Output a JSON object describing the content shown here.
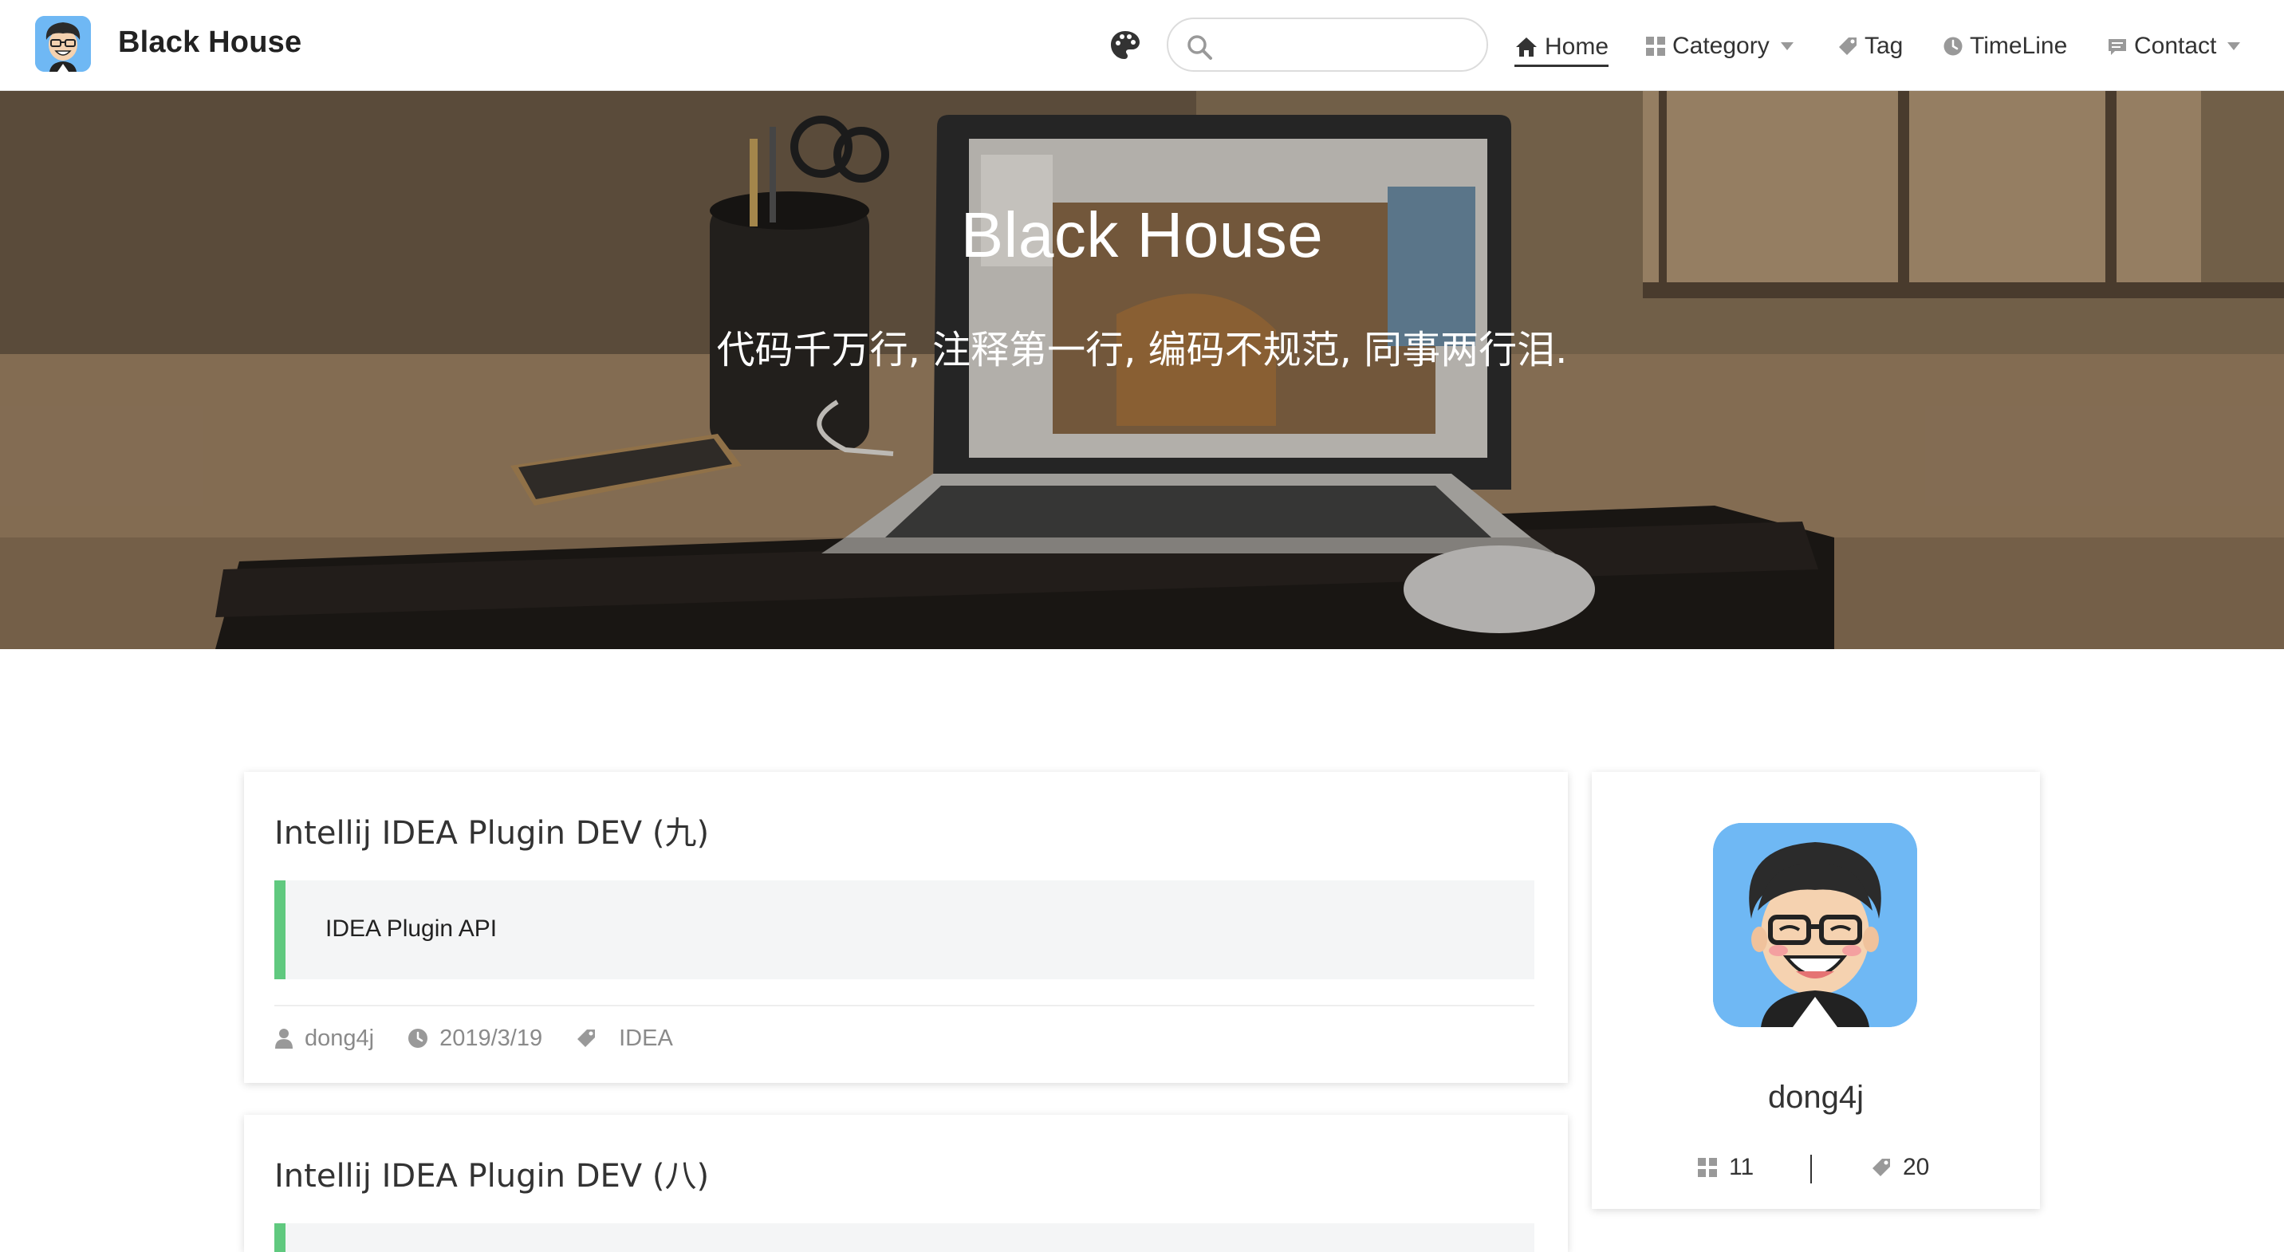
{
  "site": {
    "brand": "Black House",
    "search": {
      "placeholder": "",
      "value": ""
    },
    "nav": [
      {
        "label": "Home",
        "icon": "home-icon",
        "active": true
      },
      {
        "label": "Category",
        "icon": "category-grid-icon",
        "dropdown": true
      },
      {
        "label": "Tag",
        "icon": "tag-icon"
      },
      {
        "label": "TimeLine",
        "icon": "clock-icon"
      },
      {
        "label": "Contact",
        "icon": "message-icon",
        "dropdown": true
      }
    ]
  },
  "hero": {
    "title": "Black House",
    "subtitle": "代码千万行, 注释第一行, 编码不规范, 同事两行泪."
  },
  "posts": [
    {
      "title": "Intellij IDEA Plugin DEV (九)",
      "excerpt": "IDEA Plugin API",
      "author": "dong4j",
      "date": "2019/3/19",
      "tag": "IDEA"
    },
    {
      "title": "Intellij IDEA Plugin DEV (八)"
    }
  ],
  "profile": {
    "name": "dong4j",
    "categories_count": "11",
    "tags_count": "20"
  },
  "colors": {
    "accent_green": "#60c97f",
    "avatar_bg": "#6fb8f4",
    "excerpt_bg": "#f4f5f6"
  }
}
